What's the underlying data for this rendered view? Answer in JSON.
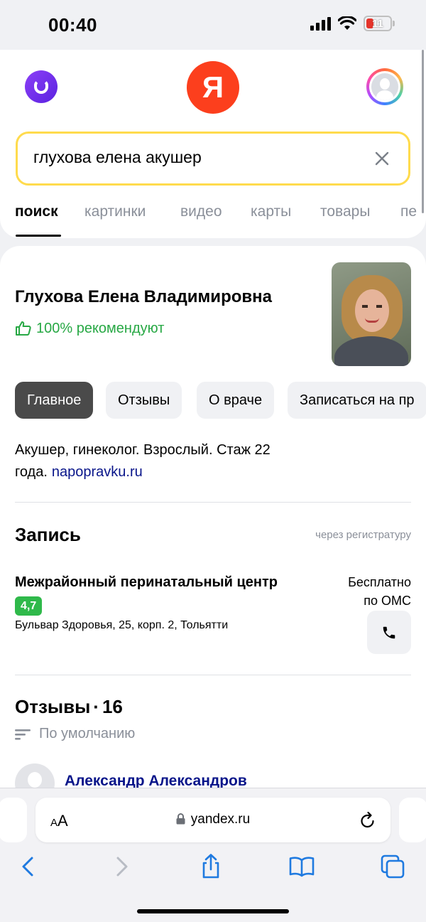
{
  "status_bar": {
    "time": "00:40",
    "battery": "11"
  },
  "header": {
    "logo": "Я",
    "search": {
      "value": "глухова елена акушер"
    },
    "tabs": [
      "поиск",
      "картинки",
      "видео",
      "карты",
      "товары",
      "пе"
    ]
  },
  "doctor": {
    "name": "Глухова Елена Владимировна",
    "recommend": "100% рекомендуют",
    "chips": [
      "Главное",
      "Отзывы",
      "О враче",
      "Записаться на пр"
    ],
    "about_text": "Акушер, гинеколог. Взрослый. Стаж 22 года.",
    "about_link": "napopravku.ru"
  },
  "booking": {
    "title": "Запись",
    "hint": "через регистратуру",
    "clinic_name": "Межрайонный перинатальный центр",
    "rating": "4,7",
    "address": "Бульвар Здоровья, 25, корп. 2, Тольятти",
    "price_line1": "Бесплатно",
    "price_line2": "по ОМС"
  },
  "reviews": {
    "title": "Отзывы",
    "count": "16",
    "sort_label": "По умолчанию",
    "first_reviewer": "Александр Александров"
  },
  "browser": {
    "aa_small": "A",
    "aa_large": "A",
    "url": "yandex.ru"
  },
  "colors": {
    "accent_red": "#fc3f1d",
    "search_border": "#ffdb4d",
    "recommend_green": "#27a844",
    "rating_green": "#2fb94a",
    "link_blue": "#08158a",
    "safari_blue": "#1f7ae0"
  }
}
